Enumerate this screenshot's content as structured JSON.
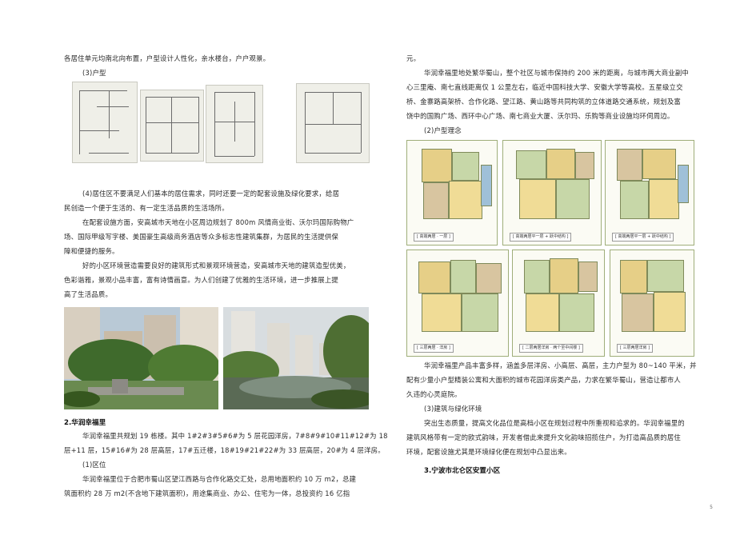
{
  "left": {
    "line1": "各居住单元均南北向布置，户型设计人性化，亲水楼台，户户观景。",
    "sub_huxing": "(3)户型",
    "para4": [
      "(4)居住区不要满足人们基本的居住需求，同时还要一定的配套设施及绿化要求，给居",
      "民创造一个便于生活的、有一定生活品质的生活场所。"
    ],
    "para_peitao": [
      "在配套设施方面，安高城市天地在小区周边规划了 800m 风情商业街、沃尔玛国际购物广",
      "场、国际甲级写字楼、美国豪生高级商务酒店等众多标志性建筑集群，为居民的生活提供保",
      "障和便捷的服务。"
    ],
    "para_huanjing": [
      "好的小区环境营造需要良好的建筑形式和景观环境营造，安高城市天地的建筑造型优美，",
      "色彩谐雅，景观小品丰富，富有诗情画意。为人们创建了优雅的生活环境，进一步推展上提",
      "高了生活品质。"
    ],
    "heading2": "2.华润幸福里",
    "para_guihua": [
      "华润幸福里共规划 19 栋楼。其中 1#2#3#5#6#为 5 层花园洋房，7#8#9#10#11#12#为 18",
      "层+11 层，15#16#为 28 层高层，17#五迁楼，18#19#21#22#为 33 层高层，20#为 4 层洋房。"
    ],
    "sub_quwei": "(1)区位",
    "para_quwei": [
      "华润幸福里位于合肥市蜀山区望江西路与合作化路交汇处，总用地面积约 10 万 m2，总建",
      "筑面积约 28 万 m2(不含地下建筑面积)，用途集商业、办公、住宅为一体，总投资约   16 亿指"
    ]
  },
  "right": {
    "line_top": "元。",
    "para_jiaotong": [
      "华润幸福里地处繁华蜀山，整个社区与城市保持约 200 米的距离，与城市两大商业副中",
      "心三里庵、南七直线距离仅 1 公里左右，临近中国科技大学、安徽大学等高校。五星级立交",
      "桥、金寨路高架桥、合作化路、望江路、黄山路等共同构筑的立体道路交通系统，规划及富",
      "饶中的国购广场、西环中心广场、南七商业大厦、沃尔玛、乐购等商业设施均环伺周边。"
    ],
    "sub_linian": "(2)户型理念",
    "plan_captions": [
      "[ 高端两居 · 一层 ]",
      "[ 高端两居平一层 + 跃中结构 ]",
      "[ 高端两居平一层 + 跃中结构 ]",
      "[ 三层两居 · 洋房 ]",
      "[ 二层两居洋房 · 两个至中间楼 ]",
      "[ 三层两居洋房 ]"
    ],
    "para_chanpin": [
      "华润幸福里产品丰富多样，涵盖多层洋房、小高层、高层，主力户型为 80~140 平米，并",
      "配有少量小户型精装公寓和大面积的城市花园洋房类产品，力求在繁华蜀山，营造让都市人",
      "久违的心灵庭院。"
    ],
    "sub_jianzhu": "(3)建筑与绿化环境",
    "para_jianzhu": [
      "突出生态质量，提高文化品位是高档小区在规划过程中所重视和追求的。华润幸福里的",
      "建筑风格带有一定的欧式韵味，开发者借此来提升文化韵味招揽住户，为打造高品质的居住",
      "环境，配套设施尤其是环境绿化便在规划中凸显出来。"
    ],
    "heading3": "3.宁波市北仑区安置小区"
  },
  "page_number": "5"
}
